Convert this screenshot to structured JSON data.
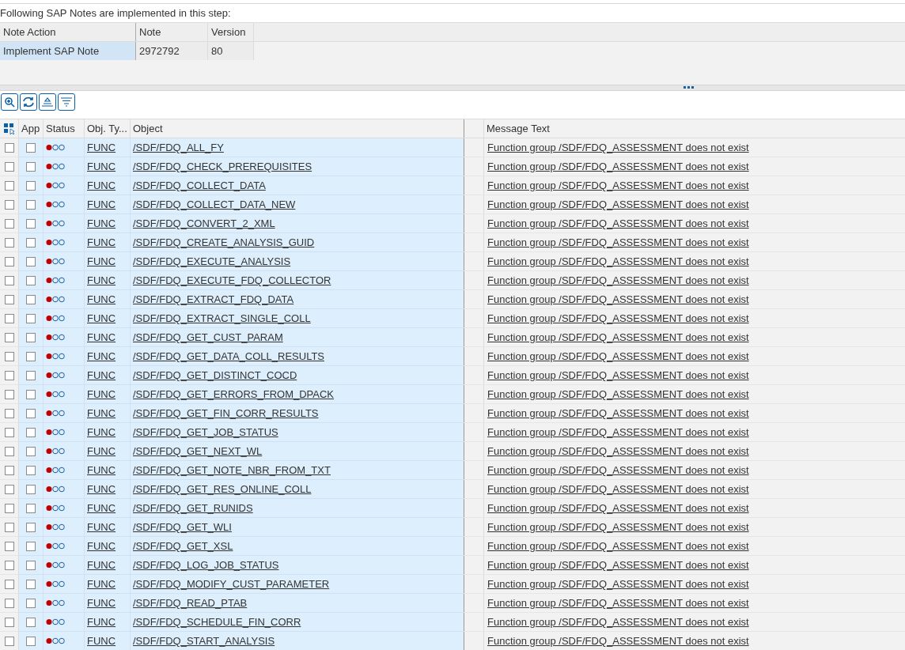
{
  "intro": "Following SAP Notes are implemented in this step:",
  "notes_table": {
    "columns": [
      "Note Action",
      "Note",
      "Version"
    ],
    "rows": [
      {
        "cells": [
          "Implement SAP Note",
          "2972792",
          "80"
        ],
        "selected": true
      }
    ]
  },
  "toolbar": [
    {
      "kind": "zoom"
    },
    {
      "kind": "refresh"
    },
    {
      "kind": "sort-up"
    },
    {
      "kind": "filter"
    }
  ],
  "objects_table": {
    "columns": [
      "App",
      "Status",
      "Obj. Ty...",
      "Object",
      "Message Text"
    ],
    "rows": [
      {
        "checked_select": false,
        "checked_app": false,
        "color": "#c00000",
        "type": "FUNC",
        "object": "/SDF/FDQ_ALL_FY",
        "message": "Function group /SDF/FDQ_ASSESSMENT does not exist"
      },
      {
        "checked_select": false,
        "checked_app": false,
        "color": "#c00000",
        "type": "FUNC",
        "object": "/SDF/FDQ_CHECK_PREREQUISITES",
        "message": "Function group /SDF/FDQ_ASSESSMENT does not exist"
      },
      {
        "checked_select": false,
        "checked_app": false,
        "color": "#c00000",
        "type": "FUNC",
        "object": "/SDF/FDQ_COLLECT_DATA",
        "message": "Function group /SDF/FDQ_ASSESSMENT does not exist"
      },
      {
        "checked_select": false,
        "checked_app": false,
        "color": "#c00000",
        "type": "FUNC",
        "object": "/SDF/FDQ_COLLECT_DATA_NEW",
        "message": "Function group /SDF/FDQ_ASSESSMENT does not exist"
      },
      {
        "checked_select": false,
        "checked_app": false,
        "color": "#c00000",
        "type": "FUNC",
        "object": "/SDF/FDQ_CONVERT_2_XML",
        "message": "Function group /SDF/FDQ_ASSESSMENT does not exist"
      },
      {
        "checked_select": false,
        "checked_app": false,
        "color": "#c00000",
        "type": "FUNC",
        "object": "/SDF/FDQ_CREATE_ANALYSIS_GUID",
        "message": "Function group /SDF/FDQ_ASSESSMENT does not exist"
      },
      {
        "checked_select": false,
        "checked_app": false,
        "color": "#c00000",
        "type": "FUNC",
        "object": "/SDF/FDQ_EXECUTE_ANALYSIS",
        "message": "Function group /SDF/FDQ_ASSESSMENT does not exist"
      },
      {
        "checked_select": false,
        "checked_app": false,
        "color": "#c00000",
        "type": "FUNC",
        "object": "/SDF/FDQ_EXECUTE_FDQ_COLLECTOR",
        "message": "Function group /SDF/FDQ_ASSESSMENT does not exist"
      },
      {
        "checked_select": false,
        "checked_app": false,
        "color": "#c00000",
        "type": "FUNC",
        "object": "/SDF/FDQ_EXTRACT_FDQ_DATA",
        "message": "Function group /SDF/FDQ_ASSESSMENT does not exist"
      },
      {
        "checked_select": false,
        "checked_app": false,
        "color": "#c00000",
        "type": "FUNC",
        "object": "/SDF/FDQ_EXTRACT_SINGLE_COLL",
        "message": "Function group /SDF/FDQ_ASSESSMENT does not exist"
      },
      {
        "checked_select": false,
        "checked_app": false,
        "color": "#c00000",
        "type": "FUNC",
        "object": "/SDF/FDQ_GET_CUST_PARAM",
        "message": "Function group /SDF/FDQ_ASSESSMENT does not exist"
      },
      {
        "checked_select": false,
        "checked_app": false,
        "color": "#c00000",
        "type": "FUNC",
        "object": "/SDF/FDQ_GET_DATA_COLL_RESULTS",
        "message": "Function group /SDF/FDQ_ASSESSMENT does not exist"
      },
      {
        "checked_select": false,
        "checked_app": false,
        "color": "#c00000",
        "type": "FUNC",
        "object": "/SDF/FDQ_GET_DISTINCT_COCD",
        "message": "Function group /SDF/FDQ_ASSESSMENT does not exist"
      },
      {
        "checked_select": false,
        "checked_app": false,
        "color": "#c00000",
        "type": "FUNC",
        "object": "/SDF/FDQ_GET_ERRORS_FROM_DPACK",
        "message": "Function group /SDF/FDQ_ASSESSMENT does not exist"
      },
      {
        "checked_select": false,
        "checked_app": false,
        "color": "#c00000",
        "type": "FUNC",
        "object": "/SDF/FDQ_GET_FIN_CORR_RESULTS",
        "message": "Function group /SDF/FDQ_ASSESSMENT does not exist"
      },
      {
        "checked_select": false,
        "checked_app": false,
        "color": "#c00000",
        "type": "FUNC",
        "object": "/SDF/FDQ_GET_JOB_STATUS",
        "message": "Function group /SDF/FDQ_ASSESSMENT does not exist"
      },
      {
        "checked_select": false,
        "checked_app": false,
        "color": "#c00000",
        "type": "FUNC",
        "object": "/SDF/FDQ_GET_NEXT_WL",
        "message": "Function group /SDF/FDQ_ASSESSMENT does not exist"
      },
      {
        "checked_select": false,
        "checked_app": false,
        "color": "#c00000",
        "type": "FUNC",
        "object": "/SDF/FDQ_GET_NOTE_NBR_FROM_TXT",
        "message": "Function group /SDF/FDQ_ASSESSMENT does not exist"
      },
      {
        "checked_select": false,
        "checked_app": false,
        "color": "#c00000",
        "type": "FUNC",
        "object": "/SDF/FDQ_GET_RES_ONLINE_COLL",
        "message": "Function group /SDF/FDQ_ASSESSMENT does not exist"
      },
      {
        "checked_select": false,
        "checked_app": false,
        "color": "#c00000",
        "type": "FUNC",
        "object": "/SDF/FDQ_GET_RUNIDS",
        "message": "Function group /SDF/FDQ_ASSESSMENT does not exist"
      },
      {
        "checked_select": false,
        "checked_app": false,
        "color": "#c00000",
        "type": "FUNC",
        "object": "/SDF/FDQ_GET_WLI",
        "message": "Function group /SDF/FDQ_ASSESSMENT does not exist"
      },
      {
        "checked_select": false,
        "checked_app": false,
        "color": "#c00000",
        "type": "FUNC",
        "object": "/SDF/FDQ_GET_XSL",
        "message": "Function group /SDF/FDQ_ASSESSMENT does not exist"
      },
      {
        "checked_select": false,
        "checked_app": false,
        "color": "#c00000",
        "type": "FUNC",
        "object": "/SDF/FDQ_LOG_JOB_STATUS",
        "message": "Function group /SDF/FDQ_ASSESSMENT does not exist"
      },
      {
        "checked_select": false,
        "checked_app": false,
        "color": "#c00000",
        "type": "FUNC",
        "object": "/SDF/FDQ_MODIFY_CUST_PARAMETER",
        "message": "Function group /SDF/FDQ_ASSESSMENT does not exist"
      },
      {
        "checked_select": false,
        "checked_app": false,
        "color": "#c00000",
        "type": "FUNC",
        "object": "/SDF/FDQ_READ_PTAB",
        "message": "Function group /SDF/FDQ_ASSESSMENT does not exist"
      },
      {
        "checked_select": false,
        "checked_app": false,
        "color": "#c00000",
        "type": "FUNC",
        "object": "/SDF/FDQ_SCHEDULE_FIN_CORR",
        "message": "Function group /SDF/FDQ_ASSESSMENT does not exist"
      },
      {
        "checked_select": false,
        "checked_app": false,
        "color": "#c00000",
        "type": "FUNC",
        "object": "/SDF/FDQ_START_ANALYSIS",
        "message": "Function group /SDF/FDQ_ASSESSMENT does not exist"
      }
    ]
  }
}
